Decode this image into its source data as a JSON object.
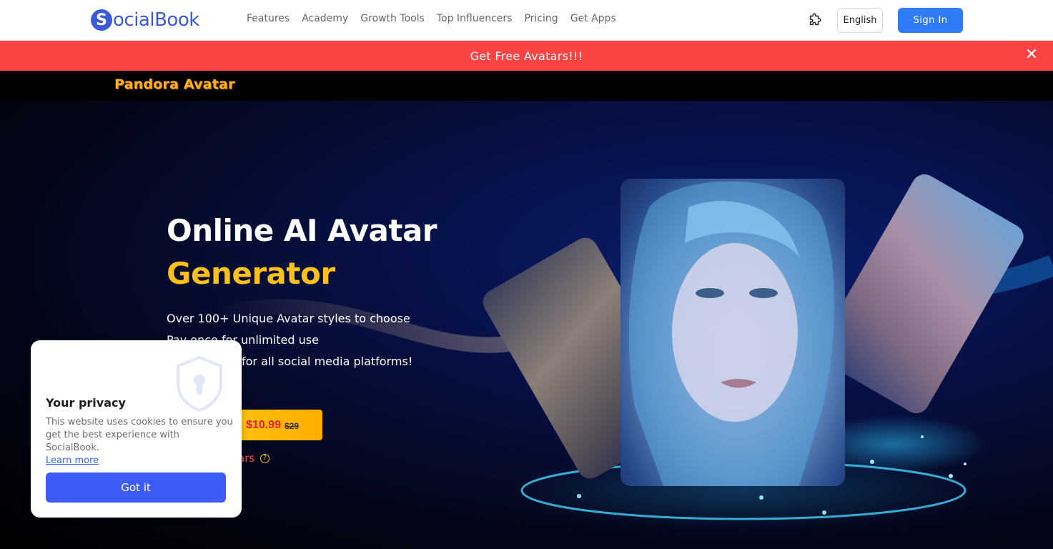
{
  "nav": {
    "logo_initial": "S",
    "logo_text": "ocialBook",
    "items": [
      {
        "label": "Features"
      },
      {
        "label": "Academy"
      },
      {
        "label": "Growth Tools"
      },
      {
        "label": "Top Influencers"
      },
      {
        "label": "Pricing"
      },
      {
        "label": "Get Apps"
      }
    ],
    "extension_icon": "puzzle-icon",
    "language": "English",
    "signin_label": "Sign In"
  },
  "banner": {
    "text": "Get Free Avatars!!!",
    "close_icon": "close-icon",
    "color": "#fa4444"
  },
  "subheader": {
    "brand": "Pandora Avatar"
  },
  "hero": {
    "title_line1": "Online AI Avatar",
    "title_line2": "Generator",
    "features": [
      "Over 100+ Unique Avatar styles to choose",
      "Pay once for unlimited use",
      "for all social media platforms!"
    ],
    "cta_price": "$10.99",
    "cta_old_price": "$29",
    "free_link": "ars",
    "help_icon": "help-icon",
    "accent_color": "#fdbf1c"
  },
  "cookie": {
    "icon": "shield-lock-icon",
    "title": "Your privacy",
    "text": "This website uses cookies to ensure you get the best experience with SocialBook.",
    "link": "Learn more",
    "button": "Got it",
    "button_color": "#3d5cf7"
  }
}
